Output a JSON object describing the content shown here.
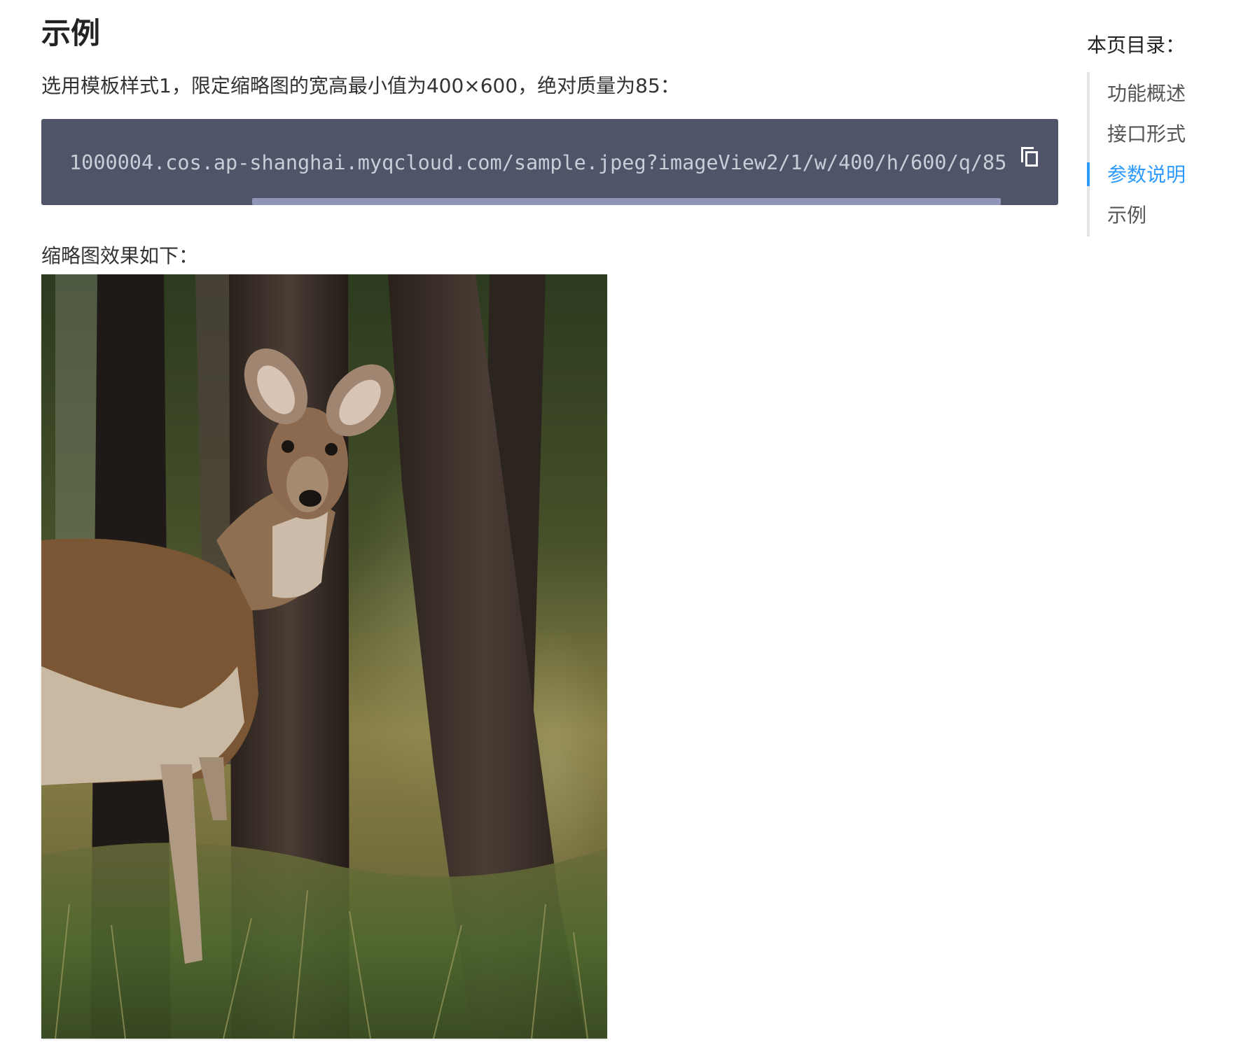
{
  "main": {
    "heading": "示例",
    "intro": "选用模板样式1，限定缩略图的宽高最小值为400×600，绝对质量为85：",
    "code": "1000004.cos.ap-shanghai.myqcloud.com/sample.jpeg?imageView2/1/w/400/h/600/q/85",
    "copy_icon": "copy-icon",
    "result_caption": "缩略图效果如下："
  },
  "toc": {
    "title": "本页目录：",
    "items": [
      {
        "label": "功能概述",
        "active": false
      },
      {
        "label": "接口形式",
        "active": false
      },
      {
        "label": "参数说明",
        "active": true
      },
      {
        "label": "示例",
        "active": false
      }
    ],
    "active_color": "#2f9bff"
  },
  "colors": {
    "code_bg": "#4f5469",
    "code_text": "#c9cdd8",
    "scrollbar": "#8e95b8"
  }
}
